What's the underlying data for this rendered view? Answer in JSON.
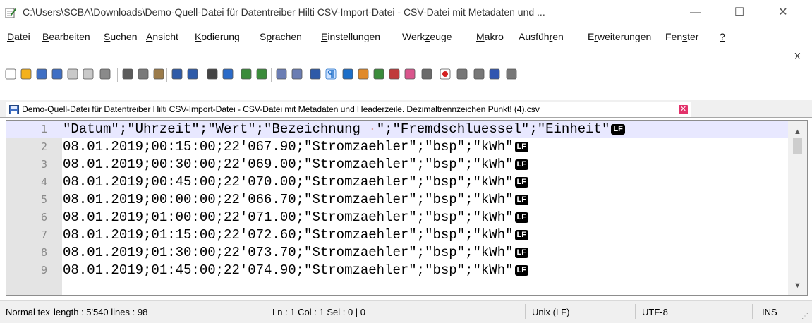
{
  "window": {
    "title": "C:\\Users\\SCBA\\Downloads\\Demo-Quell-Datei für Datentreiber Hilti CSV-Import-Datei - CSV-Datei mit Metadaten und ...",
    "minimize_glyph": "—",
    "maximize_glyph": "☐",
    "close_glyph": "✕"
  },
  "menu": {
    "items": [
      {
        "pre": "",
        "ul": "D",
        "post": "atei"
      },
      {
        "pre": "",
        "ul": "B",
        "post": "earbeiten"
      },
      {
        "pre": "",
        "ul": "S",
        "post": "uchen"
      },
      {
        "pre": "",
        "ul": "A",
        "post": "nsicht"
      },
      {
        "pre": "",
        "ul": "K",
        "post": "odierung"
      },
      {
        "pre": "S",
        "ul": "p",
        "post": "rachen"
      },
      {
        "pre": "",
        "ul": "E",
        "post": "instellungen"
      },
      {
        "pre": "Werk",
        "ul": "z",
        "post": "euge"
      },
      {
        "pre": "",
        "ul": "M",
        "post": "akro"
      },
      {
        "pre": "Ausfüh",
        "ul": "r",
        "post": "en"
      },
      {
        "pre": "E",
        "ul": "r",
        "post": "weiterungen"
      },
      {
        "pre": "Fen",
        "ul": "s",
        "post": "ter"
      },
      {
        "pre": "",
        "ul": "?",
        "post": ""
      }
    ],
    "close_label": "X"
  },
  "toolbar": {
    "icons": [
      "new-file-icon",
      "open-file-icon",
      "save-icon",
      "save-all-icon",
      "close-icon",
      "close-all-icon",
      "print-icon",
      "cut-icon",
      "copy-icon",
      "paste-icon",
      "undo-icon",
      "redo-icon",
      "find-icon",
      "replace-icon",
      "zoom-in-icon",
      "zoom-out-icon",
      "sync-vertical-icon",
      "sync-horizontal-icon",
      "word-wrap-icon",
      "show-all-chars-icon",
      "indent-guide-icon",
      "udl-icon",
      "doc-map-icon",
      "function-list-icon",
      "folder-workspace-icon",
      "monitoring-icon",
      "record-macro-icon",
      "stop-record-icon",
      "play-macro-icon",
      "run-macro-multiple-icon",
      "save-macro-icon"
    ]
  },
  "tab": {
    "label": "Demo-Quell-Datei für Datentreiber Hilti CSV-Import-Datei - CSV-Datei mit Metadaten und Headerzeile. Dezimaltrennzeichen  Punkt! (4).csv",
    "close_glyph": "✕"
  },
  "editor": {
    "eol_marker": "LF",
    "whitespace_dot": "·",
    "lines": [
      {
        "num": "1",
        "pre": "\"Datum\";\"Uhrzeit\";\"Wert\";\"Bezeichnung ",
        "post": "\";\"Fremdschluessel\";\"Einheit\""
      },
      {
        "num": "2",
        "text": "08.01.2019;00:15:00;22'067.90;\"Stromzaehler\";\"bsp\";\"kWh\""
      },
      {
        "num": "3",
        "text": "08.01.2019;00:30:00;22'069.00;\"Stromzaehler\";\"bsp\";\"kWh\""
      },
      {
        "num": "4",
        "text": "08.01.2019;00:45:00;22'070.00;\"Stromzaehler\";\"bsp\";\"kWh\""
      },
      {
        "num": "5",
        "text": "08.01.2019;00:00:00;22'066.70;\"Stromzaehler\";\"bsp\";\"kWh\""
      },
      {
        "num": "6",
        "text": "08.01.2019;01:00:00;22'071.00;\"Stromzaehler\";\"bsp\";\"kWh\""
      },
      {
        "num": "7",
        "text": "08.01.2019;01:15:00;22'072.60;\"Stromzaehler\";\"bsp\";\"kWh\""
      },
      {
        "num": "8",
        "text": "08.01.2019;01:30:00;22'073.70;\"Stromzaehler\";\"bsp\";\"kWh\""
      },
      {
        "num": "9",
        "text": "08.01.2019;01:45:00;22'074.90;\"Stromzaehler\";\"bsp\";\"kWh\""
      }
    ],
    "scroll_up": "▲",
    "scroll_down": "▼"
  },
  "status": {
    "lang": "Normal tex",
    "length": "length : 5'540    lines : 98",
    "position": "Ln : 1    Col : 1    Sel : 0 | 0",
    "eol": "Unix (LF)",
    "encoding": "UTF-8",
    "mode": "INS",
    "grip": "⋰"
  },
  "colors": {
    "current_line": "#e8e8ff",
    "gutter": "#e4e4e4",
    "tab_close": "#e3326b"
  }
}
